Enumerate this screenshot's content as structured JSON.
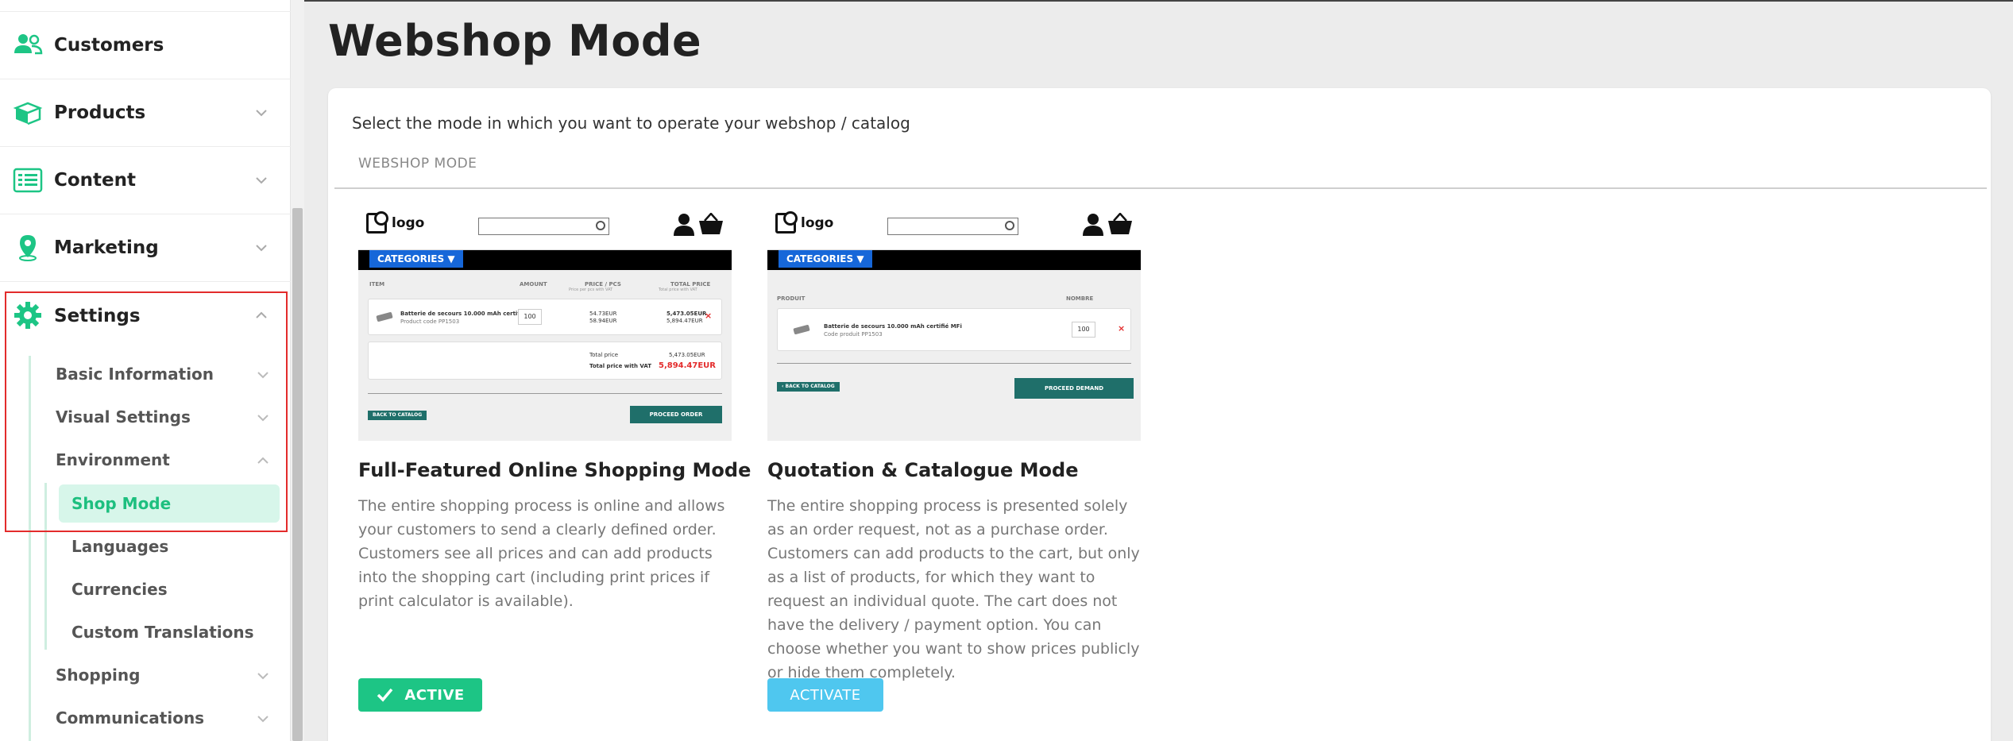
{
  "sidebar": {
    "main_items": [
      {
        "label": "Customers",
        "icon": "users-icon"
      },
      {
        "label": "Products",
        "icon": "box-icon"
      },
      {
        "label": "Content",
        "icon": "list-icon"
      },
      {
        "label": "Marketing",
        "icon": "map-pin-icon"
      },
      {
        "label": "Settings",
        "icon": "gear-icon"
      }
    ],
    "settings_items": [
      {
        "label": "Basic Information"
      },
      {
        "label": "Visual Settings"
      },
      {
        "label": "Environment"
      }
    ],
    "environment_items": [
      {
        "label": "Shop Mode",
        "active": true
      },
      {
        "label": "Languages"
      },
      {
        "label": "Currencies"
      },
      {
        "label": "Custom Translations"
      }
    ],
    "more_items": [
      {
        "label": "Shopping"
      },
      {
        "label": "Communications"
      }
    ]
  },
  "page": {
    "title": "Webshop Mode",
    "intro": "Select the mode in which you want to operate your webshop / catalog",
    "section_tab": "WEBSHOP MODE"
  },
  "modes": [
    {
      "title": "Full-Featured Online Shopping Mode",
      "description": "The entire shopping process is online and allows your customers to send a clearly defined order. Customers see all prices and can add products into the shopping cart (including print prices if print calculator is available).",
      "button": "ACTIVE",
      "preview": {
        "logo": "logo",
        "categories": "CATEGORIES ▼",
        "col_item": "ITEM",
        "col_amount": "AMOUNT",
        "col_price": "PRICE / PCS",
        "col_price_sub": "Price per pcs with VAT",
        "col_total": "TOTAL PRICE",
        "col_total_sub": "Total price with VAT",
        "product_name": "Batterie de secours 10.000 mAh certifié MFi",
        "product_code": "Product code PP1503",
        "qty": "100",
        "unit_price": "54.73EUR",
        "unit_price_vat": "58.94EUR",
        "line_total": "5,473.05EUR",
        "line_total_vat": "5,894.47EUR",
        "total_label": "Total price",
        "total_value": "5,473.05EUR",
        "total_vat_label": "Total price with VAT",
        "total_vat_value": "5,894.47EUR",
        "back_btn": "BACK TO CATALOG",
        "proceed_btn": "PROCEED ORDER"
      }
    },
    {
      "title": "Quotation & Catalogue Mode",
      "description": "The entire shopping process is presented solely as an order request, not as a purchase order. Customers can add products to the cart, but only as a list of products, for which they want to request an individual quote. The cart does not have the delivery / payment option. You can choose whether you want to show prices publicly or hide them completely.",
      "button": "ACTIVATE",
      "preview": {
        "logo": "logo",
        "categories": "CATEGORIES ▼",
        "col_item": "PRODUIT",
        "col_amount": "NOMBRE",
        "product_name": "Batterie de secours 10.000 mAh certifié MFi",
        "product_code": "Code produit PP1503",
        "qty": "100",
        "back_btn": "‹ BACK TO CATALOG",
        "proceed_btn": "PROCEED DEMAND"
      }
    }
  ],
  "colors": {
    "accent_green": "#1dc585",
    "activate_blue": "#4fc7ef",
    "highlight_red": "#e32b2b"
  }
}
